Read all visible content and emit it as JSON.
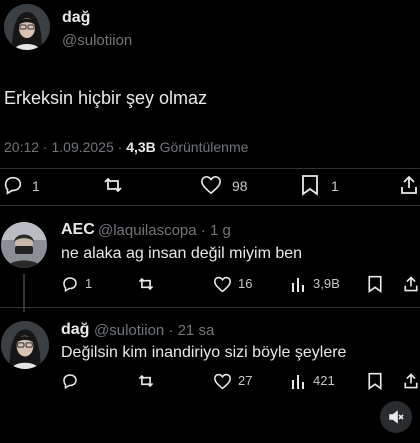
{
  "main_tweet": {
    "author_name": "dağ",
    "handle": "@sulotiion",
    "text": "Erkeksin hiçbir şey olmaz",
    "time": "20:12 · 1.09.2025 ·",
    "views_count": "4,3B",
    "views_label": "Görüntülenme",
    "reply_count": "1",
    "retweet_count": "",
    "like_count": "98",
    "bookmark_count": "1"
  },
  "reply_1": {
    "author_name": "AEC",
    "handle_meta": "@laquilascopa · 1 g",
    "text": "ne alaka ag insan değil miyim ben",
    "reply_count": "1",
    "like_count": "16",
    "views_count": "3,9B"
  },
  "reply_2": {
    "author_name": "dağ",
    "handle_meta": "@sulotiion · 21 sa",
    "text": "Değilsin kim inandiriyo sizi böyle şeylere",
    "like_count": "27",
    "views_count": "421"
  },
  "icons": [
    "reply-icon",
    "retweet-icon",
    "like-icon",
    "bookmark-icon",
    "share-icon",
    "views-icon",
    "mute-icon"
  ],
  "colors": {
    "background": "#000000",
    "text": "#e7e9ea",
    "muted": "#71767b",
    "divider": "#2f3336"
  }
}
